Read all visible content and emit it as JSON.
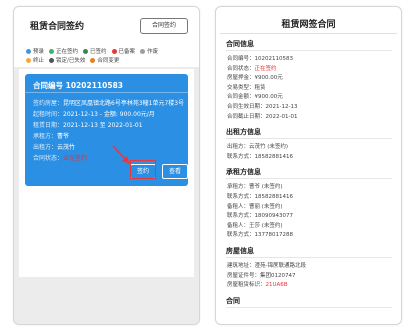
{
  "left": {
    "title": "租赁合同签约",
    "top_button": "合同签约",
    "legend_row1": [
      {
        "label": "预录",
        "color": "#3a9ad9"
      },
      {
        "label": "正在签约",
        "color": "#3cb371"
      },
      {
        "label": "已签约",
        "color": "#2e8b57"
      },
      {
        "label": "已备案",
        "color": "#e53935"
      },
      {
        "label": "作废",
        "color": "#9e9e9e"
      }
    ],
    "legend_row2": [
      {
        "label": "终止",
        "color": "#f2a93b"
      },
      {
        "label": "锁定/已失效",
        "color": "#555555"
      },
      {
        "label": "合同变更",
        "color": "#e67e22"
      }
    ],
    "card": {
      "contract_no": "合同编号 10202110583",
      "fields": [
        {
          "k": "签约房屋：",
          "v": "昆明区凤凰镇北路6号亭林苑3幢1单元7楼3号"
        },
        {
          "k": "起租时间：",
          "v": "2021-12-13 ‑ 金额: 900.00元/月"
        },
        {
          "k": "租赁日期：",
          "v": "2021-12-13 至 2022-01-01"
        },
        {
          "k": "承租方：",
          "v": "曹爷"
        },
        {
          "k": "出租方：",
          "v": "云茂竹"
        },
        {
          "k": "合同状态：",
          "v": "正在签约",
          "red": true
        }
      ],
      "sign_button": "签约",
      "view_button": "查看"
    }
  },
  "right": {
    "title": "租赁网签合同",
    "sections": [
      {
        "heading": "合同信息",
        "fields": [
          {
            "k": "合同编号：",
            "v": "10202110583"
          },
          {
            "k": "合同状态：",
            "v": "正在签约",
            "red": true
          },
          {
            "k": "房屋押金：",
            "v": "¥900.00元"
          },
          {
            "k": "交易类型：",
            "v": "租赁"
          },
          {
            "k": "合同金额：",
            "v": "¥900.00元"
          },
          {
            "k": "合同生效日期：",
            "v": "2021-12-13"
          },
          {
            "k": "合同截止日期：",
            "v": "2022-01-01"
          }
        ]
      },
      {
        "heading": "出租方信息",
        "fields": [
          {
            "k": "出租方：",
            "v": "云茂竹 (未签约)"
          },
          {
            "k": "联系方式：",
            "v": "18582881416"
          }
        ]
      },
      {
        "heading": "承租方信息",
        "fields": [
          {
            "k": "承租方：",
            "v": "曹爷 (未签约)"
          },
          {
            "k": "联系方式：",
            "v": "18582881416"
          },
          {
            "k": "备租人：",
            "v": "曹丽 (未签约)"
          },
          {
            "k": "联系方式：",
            "v": "18090943077"
          },
          {
            "k": "备租人：",
            "v": "王莎 (未签约)"
          },
          {
            "k": "联系方式：",
            "v": "13778017288"
          }
        ]
      },
      {
        "heading": "房屋信息",
        "fields": [
          {
            "k": "建筑地址：",
            "v": "澄苑-锦蔗联通路北段"
          },
          {
            "k": "房屋证件号：",
            "v": "集团0120747"
          },
          {
            "k": "房屋租赁标识：",
            "v": "21UA6B",
            "red": true
          }
        ]
      },
      {
        "heading": "合同",
        "fields": []
      }
    ]
  }
}
